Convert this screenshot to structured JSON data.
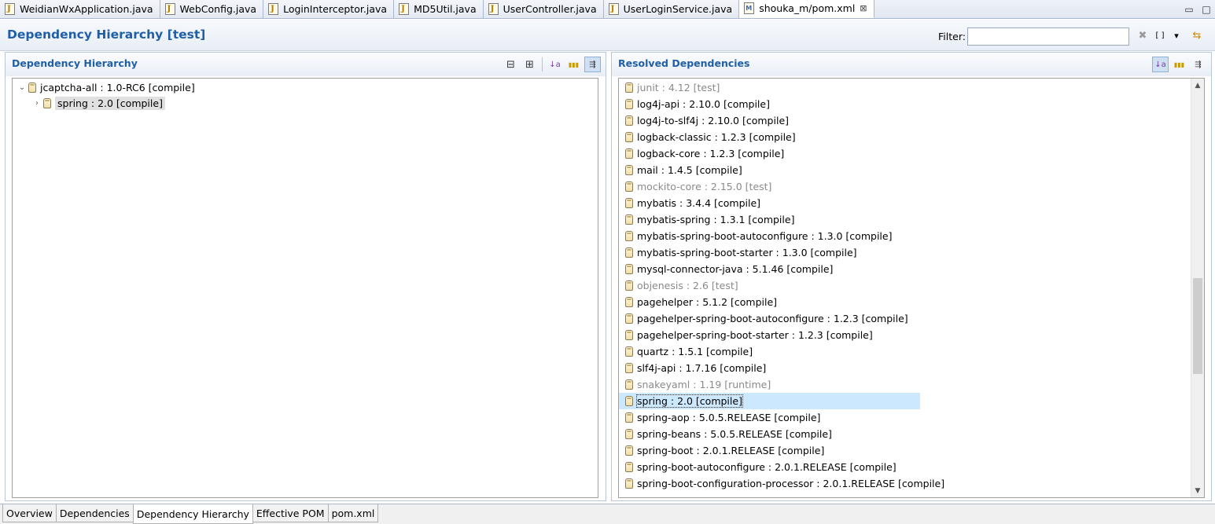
{
  "editor_tabs": [
    {
      "label": "WeidianWxApplication.java",
      "type": "java"
    },
    {
      "label": "WebConfig.java",
      "type": "java"
    },
    {
      "label": "LoginInterceptor.java",
      "type": "java"
    },
    {
      "label": "MD5Util.java",
      "type": "java"
    },
    {
      "label": "UserController.java",
      "type": "java"
    },
    {
      "label": "UserLoginService.java",
      "type": "java"
    },
    {
      "label": "shouka_m/pom.xml",
      "type": "xml",
      "active": true,
      "close": "⊠"
    }
  ],
  "window_controls": {
    "minimize": "▭",
    "maximize": "□"
  },
  "header": {
    "title": "Dependency Hierarchy [test]",
    "filter_label": "Filter:",
    "filter_value": "",
    "icons": {
      "clear": "✖",
      "brackets": "[ ]",
      "dropdown": "▾",
      "sync": "⇆"
    }
  },
  "hierarchy": {
    "title": "Dependency Hierarchy",
    "tools": {
      "collapse": "⊟",
      "expand": "⊞",
      "sort": "↓a",
      "group": "▮▮▮",
      "filter": "⇶"
    },
    "rows": [
      {
        "label": "jcaptcha-all : 1.0-RC6 [compile]",
        "level": 0,
        "twisty": "⌄"
      },
      {
        "label": "spring : 2.0 [compile]",
        "level": 1,
        "twisty": "›",
        "selected": true
      }
    ]
  },
  "resolved": {
    "title": "Resolved Dependencies",
    "tools": {
      "sort": "↓a",
      "group": "▮▮▮",
      "filter": "⇶"
    },
    "scroll": {
      "up": "▲",
      "down": "▼"
    },
    "items": [
      {
        "label": "junit : 4.12 [test]",
        "test": true
      },
      {
        "label": "log4j-api : 2.10.0 [compile]"
      },
      {
        "label": "log4j-to-slf4j : 2.10.0 [compile]"
      },
      {
        "label": "logback-classic : 1.2.3 [compile]"
      },
      {
        "label": "logback-core : 1.2.3 [compile]"
      },
      {
        "label": "mail : 1.4.5 [compile]"
      },
      {
        "label": "mockito-core : 2.15.0 [test]",
        "test": true
      },
      {
        "label": "mybatis : 3.4.4 [compile]"
      },
      {
        "label": "mybatis-spring : 1.3.1 [compile]"
      },
      {
        "label": "mybatis-spring-boot-autoconfigure : 1.3.0 [compile]"
      },
      {
        "label": "mybatis-spring-boot-starter : 1.3.0 [compile]"
      },
      {
        "label": "mysql-connector-java : 5.1.46 [compile]"
      },
      {
        "label": "objenesis : 2.6 [test]",
        "test": true
      },
      {
        "label": "pagehelper : 5.1.2 [compile]"
      },
      {
        "label": "pagehelper-spring-boot-autoconfigure : 1.2.3 [compile]"
      },
      {
        "label": "pagehelper-spring-boot-starter : 1.2.3 [compile]"
      },
      {
        "label": "quartz : 1.5.1 [compile]"
      },
      {
        "label": "slf4j-api : 1.7.16 [compile]"
      },
      {
        "label": "snakeyaml : 1.19 [runtime]",
        "test": true
      },
      {
        "label": "spring : 2.0 [compile]",
        "selected": true
      },
      {
        "label": "spring-aop : 5.0.5.RELEASE [compile]"
      },
      {
        "label": "spring-beans : 5.0.5.RELEASE [compile]"
      },
      {
        "label": "spring-boot : 2.0.1.RELEASE [compile]"
      },
      {
        "label": "spring-boot-autoconfigure : 2.0.1.RELEASE [compile]"
      },
      {
        "label": "spring-boot-configuration-processor : 2.0.1.RELEASE [compile]"
      }
    ]
  },
  "page_tabs": [
    {
      "label": "Overview"
    },
    {
      "label": "Dependencies"
    },
    {
      "label": "Dependency Hierarchy",
      "active": true
    },
    {
      "label": "Effective POM"
    },
    {
      "label": "pom.xml"
    }
  ]
}
